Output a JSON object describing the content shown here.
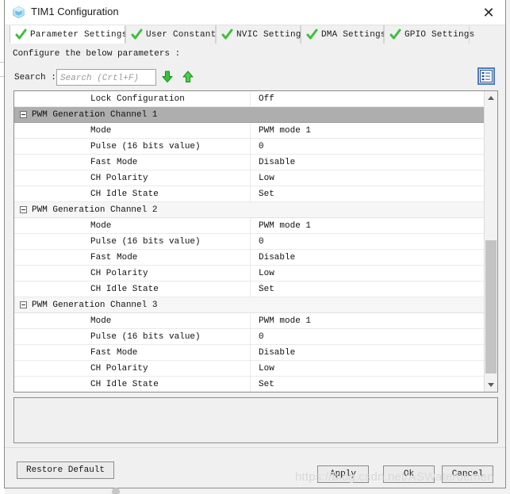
{
  "window": {
    "title": "TIM1 Configuration",
    "icon": "cube-icon",
    "close_label": "✕"
  },
  "tabs": [
    {
      "label": "Parameter Settings",
      "icon": "check-icon",
      "active": true
    },
    {
      "label": "User Constants",
      "icon": "check-icon",
      "active": false
    },
    {
      "label": "NVIC Settings",
      "icon": "check-icon",
      "active": false
    },
    {
      "label": "DMA Settings",
      "icon": "check-icon",
      "active": false
    },
    {
      "label": "GPIO Settings",
      "icon": "check-icon",
      "active": false
    }
  ],
  "main": {
    "instruction": "Configure the below parameters :",
    "search": {
      "label": "Search :",
      "value": "",
      "placeholder": "Search (Crtl+F)",
      "next_icon": "arrow-down-icon",
      "prev_icon": "arrow-up-icon"
    },
    "view_toggle_icon": "list-view-icon"
  },
  "parameters": {
    "columns": [
      "Name",
      "Value"
    ],
    "rows": [
      {
        "type": "leaf-top",
        "name": "Lock Configuration",
        "value": "Off"
      },
      {
        "type": "group",
        "name": "PWM Generation Channel 1",
        "value": "",
        "selected": true,
        "expanded": true
      },
      {
        "type": "leaf",
        "name": "Mode",
        "value": "PWM mode 1"
      },
      {
        "type": "leaf",
        "name": "Pulse (16 bits value)",
        "value": "0"
      },
      {
        "type": "leaf",
        "name": "Fast Mode",
        "value": "Disable"
      },
      {
        "type": "leaf",
        "name": "CH Polarity",
        "value": "Low"
      },
      {
        "type": "leaf",
        "name": "CH Idle State",
        "value": "Set"
      },
      {
        "type": "group",
        "name": "PWM Generation Channel 2",
        "value": "",
        "selected": false,
        "expanded": true
      },
      {
        "type": "leaf",
        "name": "Mode",
        "value": "PWM mode 1"
      },
      {
        "type": "leaf",
        "name": "Pulse (16 bits value)",
        "value": "0"
      },
      {
        "type": "leaf",
        "name": "Fast Mode",
        "value": "Disable"
      },
      {
        "type": "leaf",
        "name": "CH Polarity",
        "value": "Low"
      },
      {
        "type": "leaf",
        "name": "CH Idle State",
        "value": "Set"
      },
      {
        "type": "group",
        "name": "PWM Generation Channel 3",
        "value": "",
        "selected": false,
        "expanded": true
      },
      {
        "type": "leaf",
        "name": "Mode",
        "value": "PWM mode 1"
      },
      {
        "type": "leaf",
        "name": "Pulse (16 bits value)",
        "value": "0"
      },
      {
        "type": "leaf",
        "name": "Fast Mode",
        "value": "Disable"
      },
      {
        "type": "leaf",
        "name": "CH Polarity",
        "value": "Low"
      },
      {
        "type": "leaf",
        "name": "CH Idle State",
        "value": "Set"
      }
    ]
  },
  "footer": {
    "restore": "Restore Default",
    "apply": "Apply",
    "ok": "Ok",
    "cancel": "Cancel"
  },
  "overlay": {
    "watermark": "https://blog.csdn.net/ASWaterdemen"
  },
  "colors": {
    "accent": "#4a7ebb",
    "check": "#3fbf3f",
    "arrow": "#39c13a",
    "selected_row": "#aeaeae",
    "window_bg": "#f0f0f0"
  }
}
